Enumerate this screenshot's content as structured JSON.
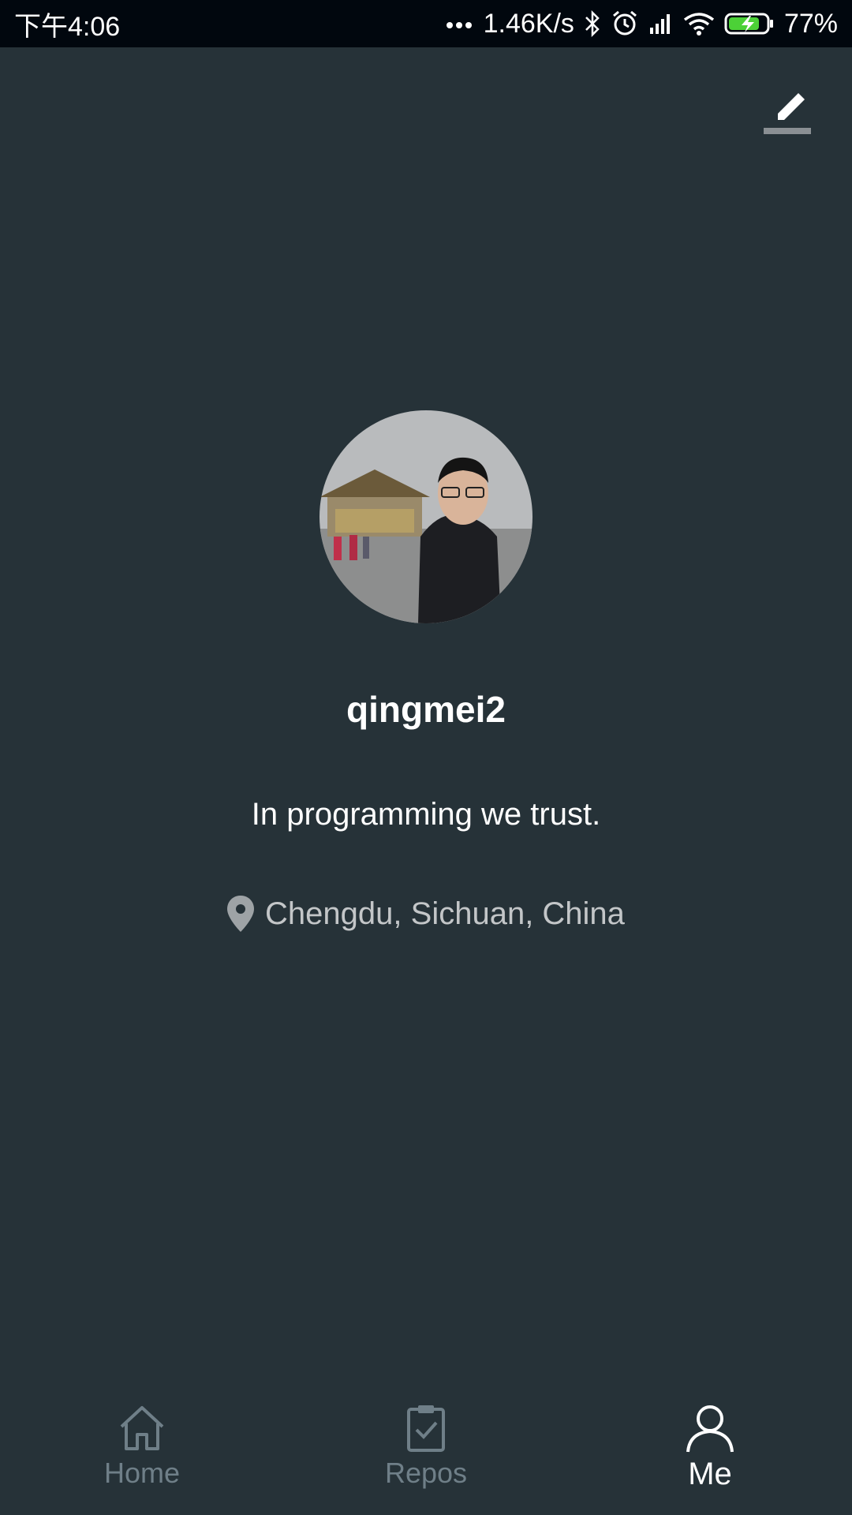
{
  "status_bar": {
    "time": "下午4:06",
    "network_speed": "1.46K/s",
    "battery": "77%"
  },
  "header": {
    "edit_icon": "edit-icon"
  },
  "profile": {
    "username": "qingmei2",
    "bio": "In programming we trust.",
    "location": "Chengdu, Sichuan, China"
  },
  "bottom_nav": {
    "items": [
      {
        "label": "Home",
        "icon": "home-icon",
        "active": false
      },
      {
        "label": "Repos",
        "icon": "clipboard-check-icon",
        "active": false
      },
      {
        "label": "Me",
        "icon": "person-icon",
        "active": true
      }
    ]
  },
  "colors": {
    "background": "#263238",
    "status_bar": "#01070e",
    "text": "#ffffff",
    "muted": "#6f7f88",
    "battery_charge": "#4cd137"
  }
}
